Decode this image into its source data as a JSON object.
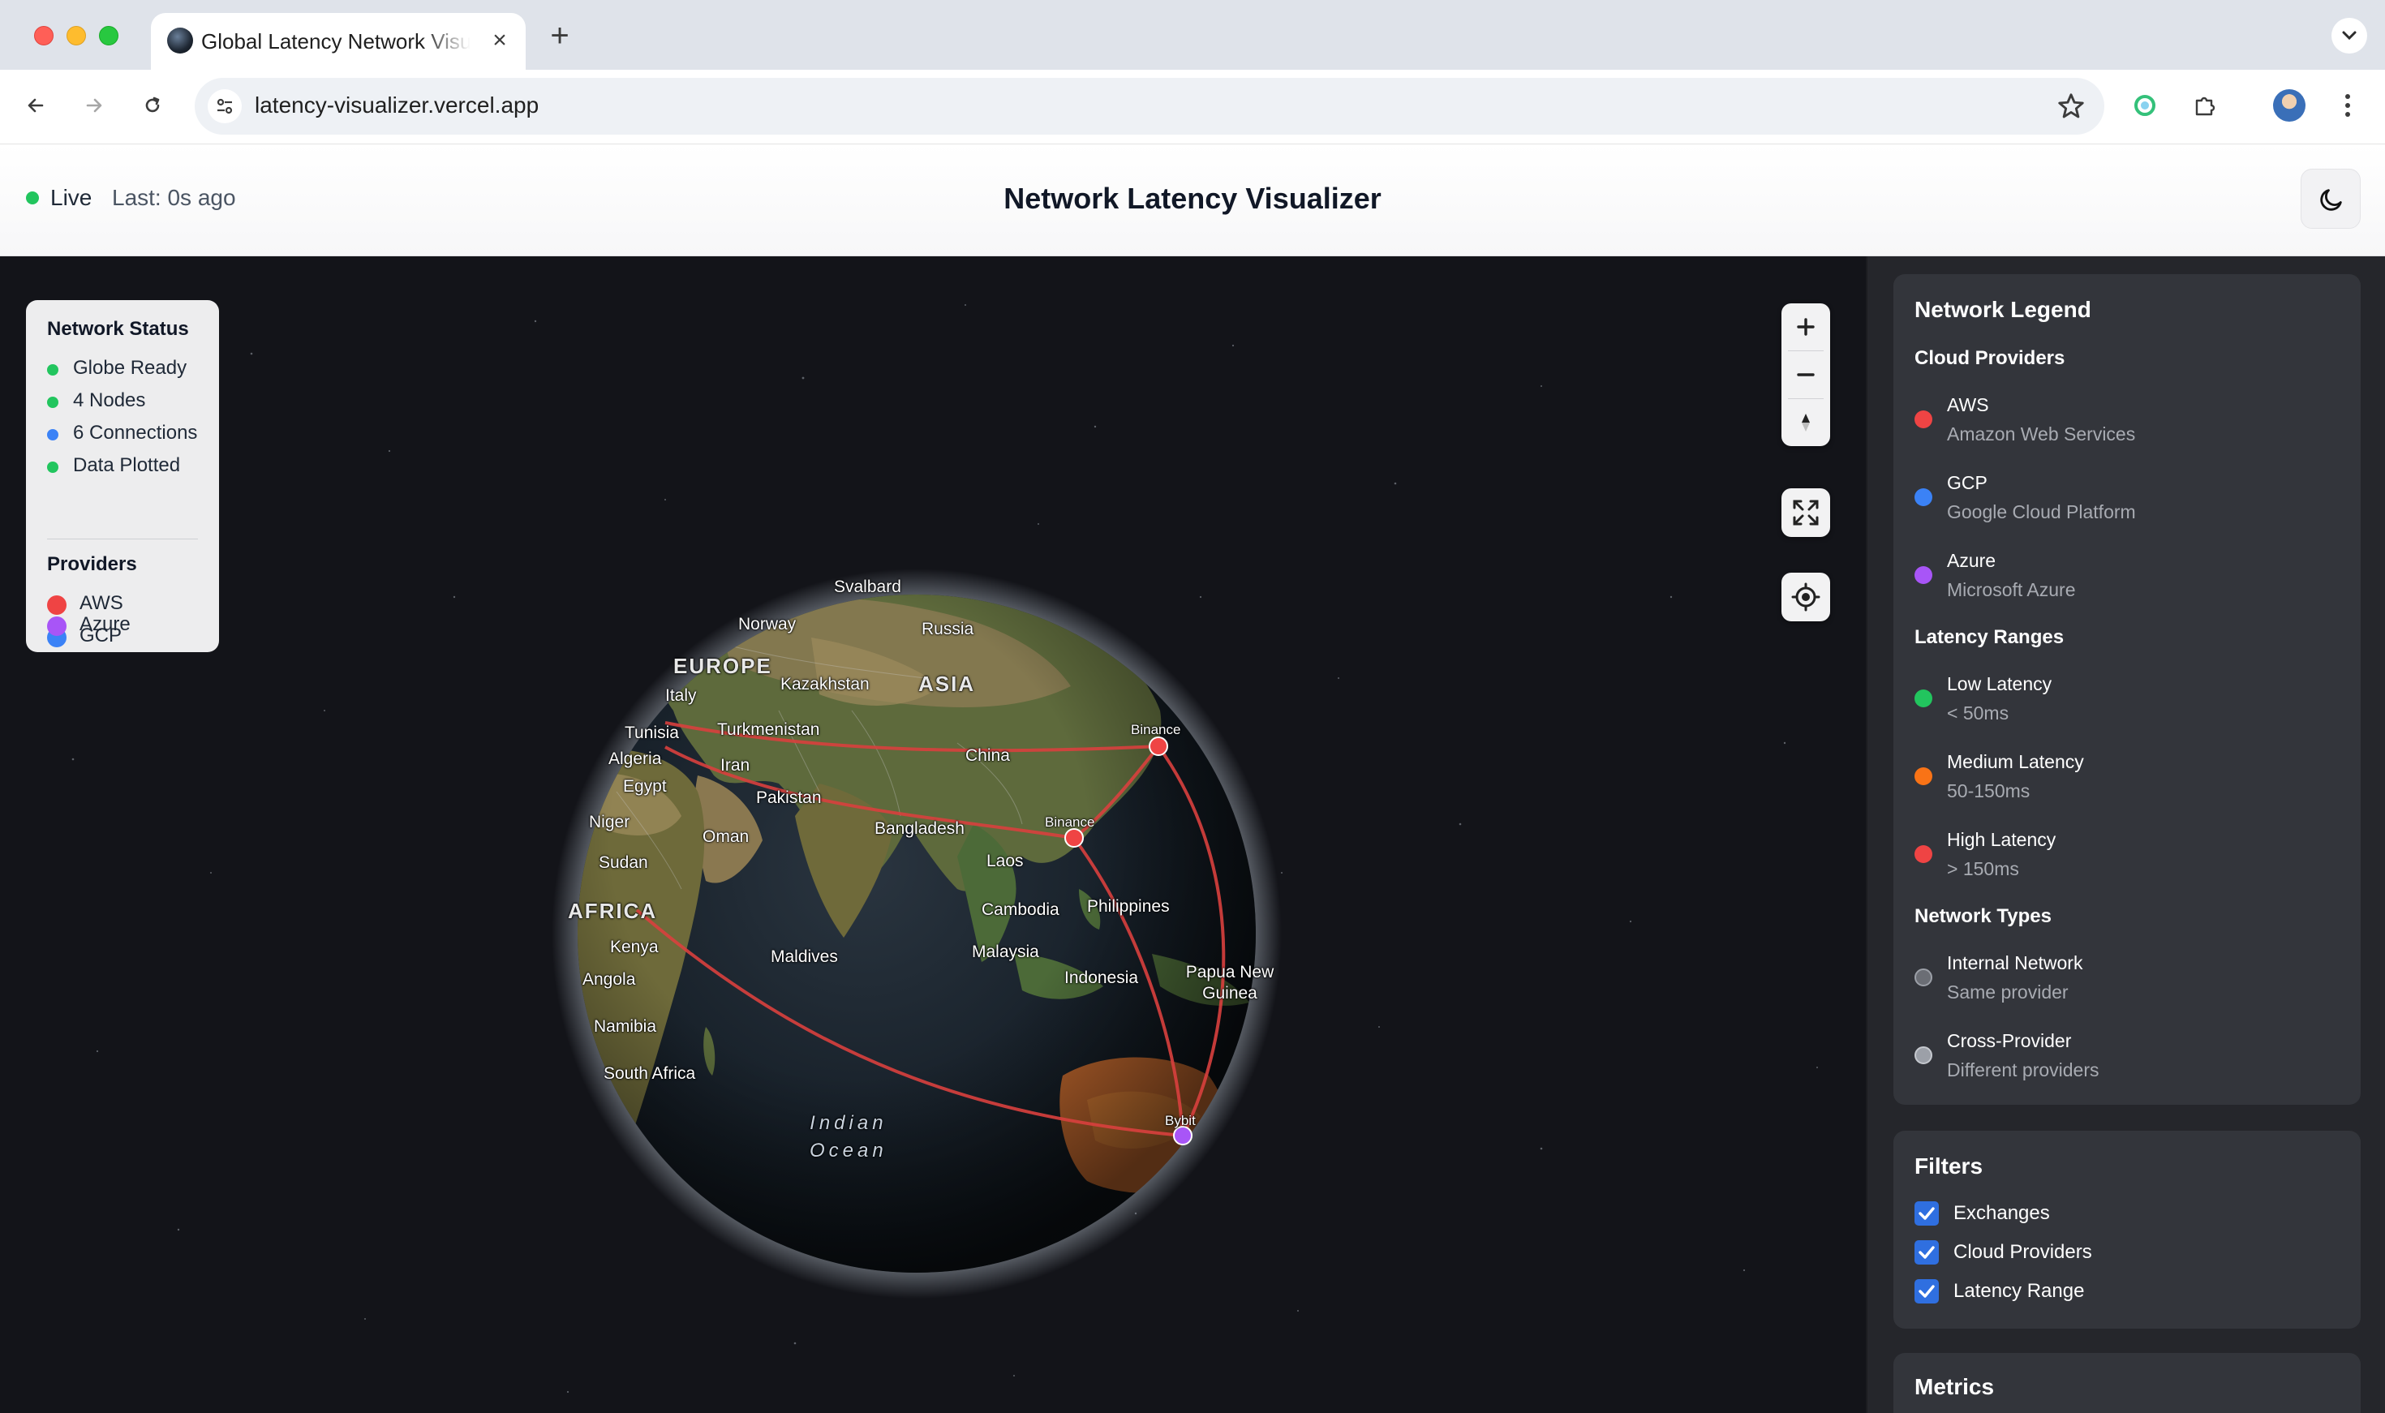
{
  "browser": {
    "tab_title": "Global Latency Network Visualizer",
    "url": "latency-visualizer.vercel.app"
  },
  "header": {
    "live_label": "Live",
    "last_update": "Last: 0s ago",
    "title": "Network Latency Visualizer"
  },
  "status_panel": {
    "title": "Network Status",
    "items": [
      {
        "label": "Globe Ready",
        "color": "#22c55e"
      },
      {
        "label": "4 Nodes",
        "color": "#22c55e"
      },
      {
        "label": "6 Connections",
        "color": "#3b82f6"
      },
      {
        "label": "Data Plotted",
        "color": "#22c55e"
      }
    ],
    "providers_title": "Providers",
    "providers": [
      {
        "label": "AWS",
        "color": "#ef4444"
      },
      {
        "label": "GCP",
        "color": "#3b82f6"
      },
      {
        "label": "Azure",
        "color": "#a855f7"
      }
    ]
  },
  "map": {
    "region_labels": [
      "EUROPE",
      "ASIA",
      "AFRICA"
    ],
    "ocean_label_lines": [
      "Indian",
      "Ocean"
    ],
    "place_labels": [
      "Svalbard",
      "Norway",
      "Russia",
      "Kazakhstan",
      "Italy",
      "Turkmenistan",
      "Tunisia",
      "Algeria",
      "Iran",
      "China",
      "Egypt",
      "Pakistan",
      "Niger",
      "Bangladesh",
      "Oman",
      "Sudan",
      "Laos",
      "Cambodia",
      "Philippines",
      "Kenya",
      "Maldives",
      "Malaysia",
      "Papua New Guinea",
      "Angola",
      "Indonesia",
      "Namibia",
      "South Africa"
    ],
    "nodes": [
      {
        "label": "Binance",
        "provider": "AWS",
        "color": "#ef4444"
      },
      {
        "label": "Binance",
        "provider": "AWS",
        "color": "#ef4444"
      },
      {
        "label": "Bybit",
        "provider": "Azure",
        "color": "#a855f7"
      }
    ],
    "connection_color": "#d9403e"
  },
  "controls": {
    "zoom_in": "zoom-in",
    "zoom_out": "zoom-out",
    "compass": "compass",
    "fullscreen": "fullscreen",
    "locate": "locate"
  },
  "legend": {
    "title": "Network Legend",
    "cloud_title": "Cloud Providers",
    "cloud": [
      {
        "name": "AWS",
        "desc": "Amazon Web Services",
        "color": "#ef4444"
      },
      {
        "name": "GCP",
        "desc": "Google Cloud Platform",
        "color": "#3b82f6"
      },
      {
        "name": "Azure",
        "desc": "Microsoft Azure",
        "color": "#a855f7"
      }
    ],
    "latency_title": "Latency Ranges",
    "latency": [
      {
        "name": "Low Latency",
        "desc": "< 50ms",
        "color": "#22c55e"
      },
      {
        "name": "Medium Latency",
        "desc": "50-150ms",
        "color": "#f97316"
      },
      {
        "name": "High Latency",
        "desc": "> 150ms",
        "color": "#ef4444"
      }
    ],
    "network_title": "Network Types",
    "network": [
      {
        "name": "Internal Network",
        "desc": "Same provider",
        "color": "#6b6e75"
      },
      {
        "name": "Cross-Provider",
        "desc": "Different providers",
        "color": "#9ca0a8"
      }
    ]
  },
  "filters": {
    "title": "Filters",
    "items": [
      {
        "label": "Exchanges",
        "checked": true
      },
      {
        "label": "Cloud Providers",
        "checked": true
      },
      {
        "label": "Latency Range",
        "checked": true
      }
    ]
  },
  "metrics": {
    "title": "Metrics"
  }
}
